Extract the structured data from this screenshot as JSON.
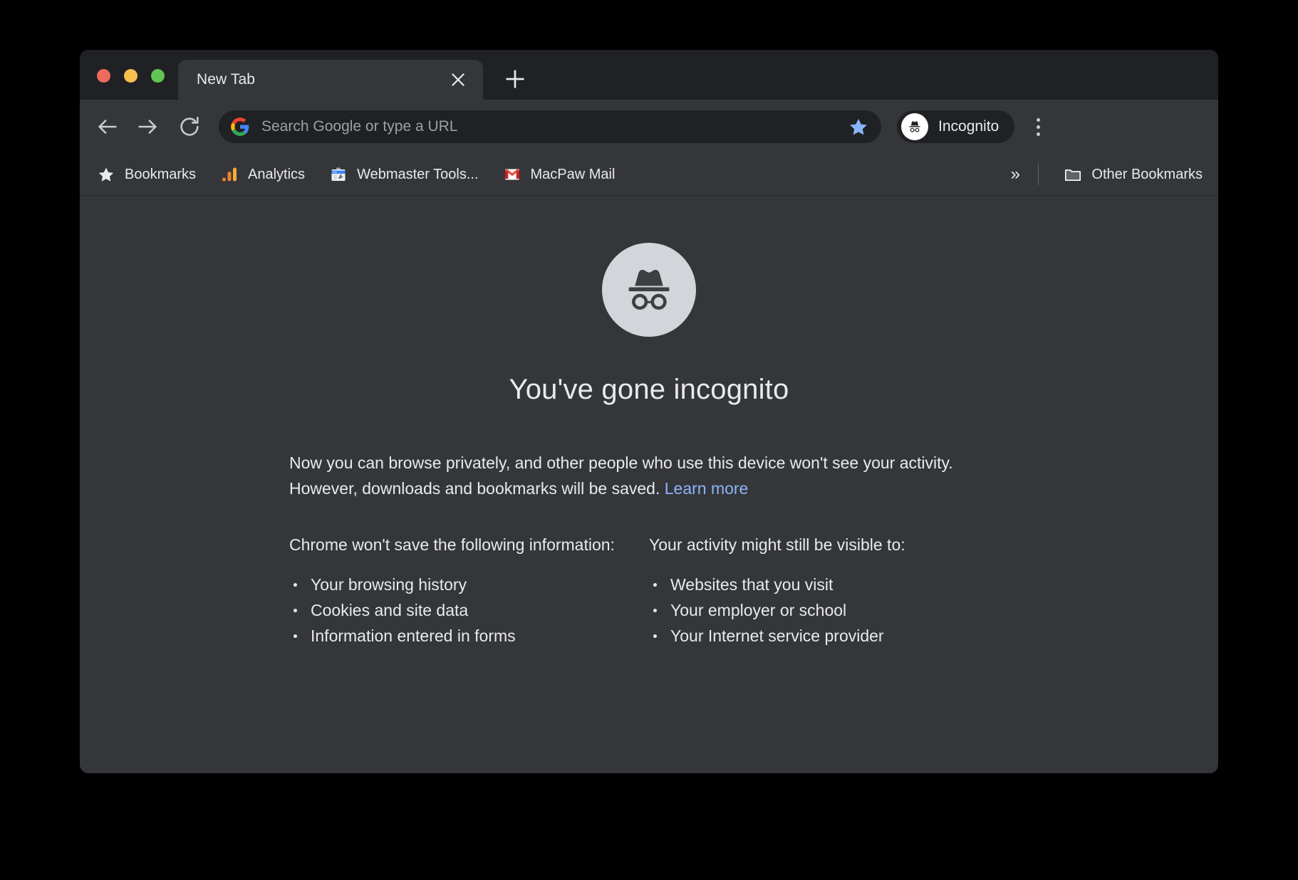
{
  "window": {
    "traffic_lights": [
      {
        "name": "close",
        "color": "#ED6A5E"
      },
      {
        "name": "minimize",
        "color": "#F5BF4F"
      },
      {
        "name": "maximize",
        "color": "#61C554"
      }
    ]
  },
  "tabstrip": {
    "tab_title": "New Tab",
    "close_icon": "close-icon",
    "new_tab_icon": "plus-icon"
  },
  "toolbar": {
    "back_icon": "arrow-left-icon",
    "forward_icon": "arrow-right-icon",
    "reload_icon": "reload-icon",
    "google_icon": "google-g-icon",
    "omnibox_placeholder": "Search Google or type a URL",
    "omnibox_value": "",
    "bookmark_star_icon": "star-icon",
    "bookmark_star_color": "#8AB4F8",
    "incognito_label": "Incognito",
    "incognito_avatar_icon": "incognito-icon",
    "menu_icon": "three-dots-icon"
  },
  "bookmarks_bar": {
    "items": [
      {
        "label": "Bookmarks",
        "icon": "star-icon"
      },
      {
        "label": "Analytics",
        "icon": "google-analytics-icon"
      },
      {
        "label": "Webmaster Tools...",
        "icon": "webmaster-tools-icon"
      },
      {
        "label": "MacPaw Mail",
        "icon": "gmail-icon"
      }
    ],
    "overflow_label": "»",
    "other_bookmarks_label": "Other Bookmarks",
    "other_bookmarks_icon": "folder-icon"
  },
  "page": {
    "hero_icon": "incognito-icon",
    "heading": "You've gone incognito",
    "intro_line_1": "Now you can browse privately, and other people who use this device won't see your activity.",
    "intro_line_2": "However, downloads and bookmarks will be saved. ",
    "learn_more_label": "Learn more",
    "columns": [
      {
        "heading": "Chrome won't save the following information:",
        "items": [
          "Your browsing history",
          "Cookies and site data",
          "Information entered in forms"
        ]
      },
      {
        "heading": "Your activity might still be visible to:",
        "items": [
          "Websites that you visit",
          "Your employer or school",
          "Your Internet service provider"
        ]
      }
    ]
  },
  "colors": {
    "tabstrip_bg": "#202124",
    "toolbar_bg": "#35363A",
    "page_bg": "#35363A",
    "omnibox_bg": "#202124",
    "text": "#E8EAED",
    "placeholder": "#9AA0A6",
    "link": "#8AB4F8",
    "hero_circle": "#D2D5D9"
  }
}
